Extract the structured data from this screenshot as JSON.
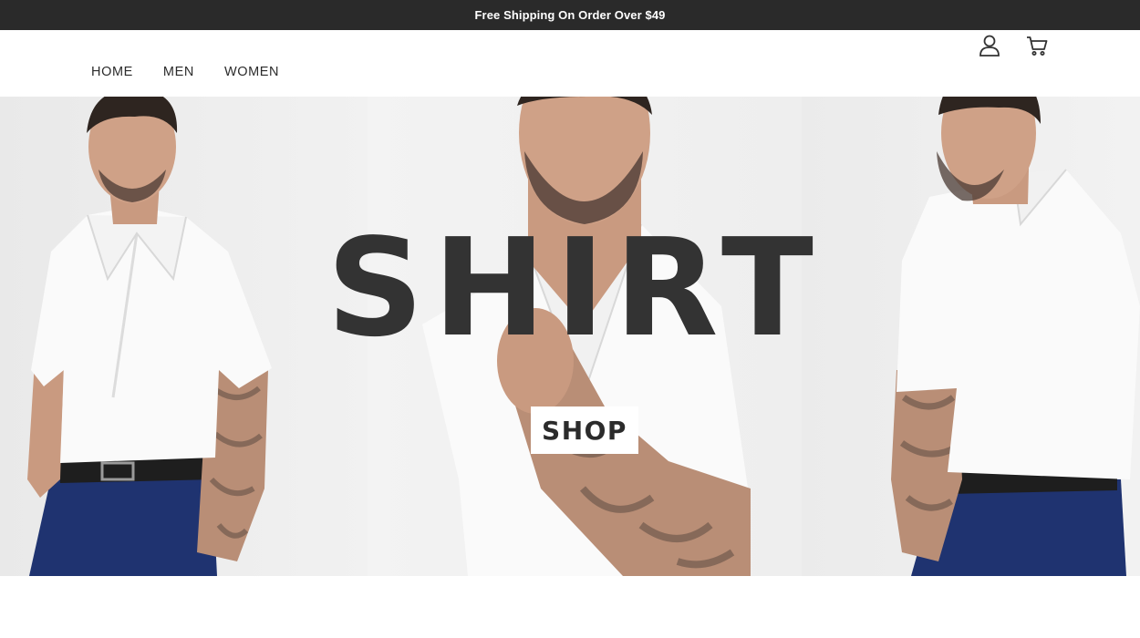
{
  "announcement": {
    "text": "Free Shipping On Order Over $49"
  },
  "nav": {
    "items": [
      {
        "label": "HOME"
      },
      {
        "label": "MEN"
      },
      {
        "label": "WOMEN"
      }
    ]
  },
  "header_icons": [
    "user-icon",
    "cart-icon"
  ],
  "hero": {
    "title": "SHIRT",
    "cta_label": "SHOP",
    "panels": [
      "model-front-photo",
      "model-closeup-photo",
      "model-side-photo"
    ]
  },
  "colors": {
    "announcement_bg": "#2a2a2a",
    "title": "#333333",
    "shirt": "#fafafa",
    "trousers": "#1f3370",
    "skin": "#c99a80"
  }
}
